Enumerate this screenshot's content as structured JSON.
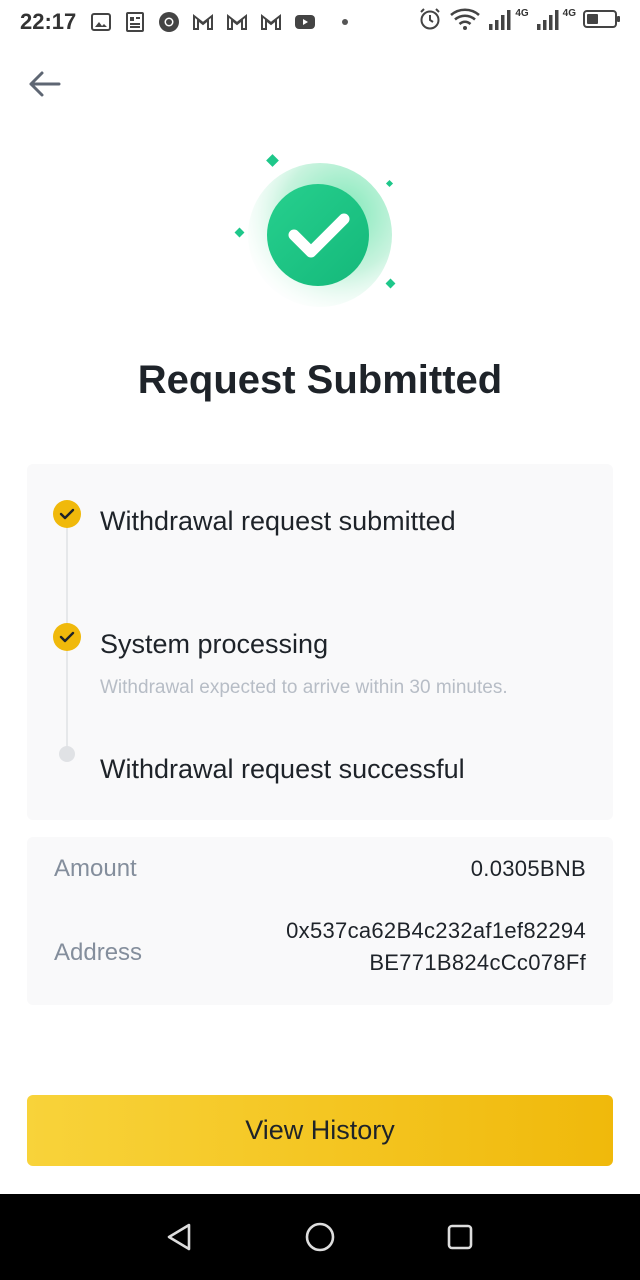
{
  "status_bar": {
    "time": "22:17",
    "left_icons": [
      "image-icon",
      "news-icon",
      "chrome-icon",
      "gmail-icon",
      "gmail-icon",
      "gmail-icon",
      "youtube-icon"
    ],
    "network_label_1": "4G",
    "network_label_2": "4G"
  },
  "header": {
    "back_icon": "arrow-left-icon"
  },
  "title": "Request Submitted",
  "steps": [
    {
      "title": "Withdrawal request submitted",
      "subtitle": "",
      "status": "done"
    },
    {
      "title": "System processing",
      "subtitle": "Withdrawal expected to arrive within 30 minutes.",
      "status": "done"
    },
    {
      "title": "Withdrawal request successful",
      "subtitle": "",
      "status": "pending"
    }
  ],
  "details": {
    "amount_label": "Amount",
    "amount_value": "0.0305BNB",
    "address_label": "Address",
    "address_line1": "0x537ca62B4c232af1ef82294",
    "address_line2": "BE771B824cCc078Ff"
  },
  "button": {
    "label": "View History"
  },
  "colors": {
    "accent": "#f0b90b",
    "success": "#1ec78a",
    "text_primary": "#1e2329",
    "text_secondary": "#848e9c"
  }
}
